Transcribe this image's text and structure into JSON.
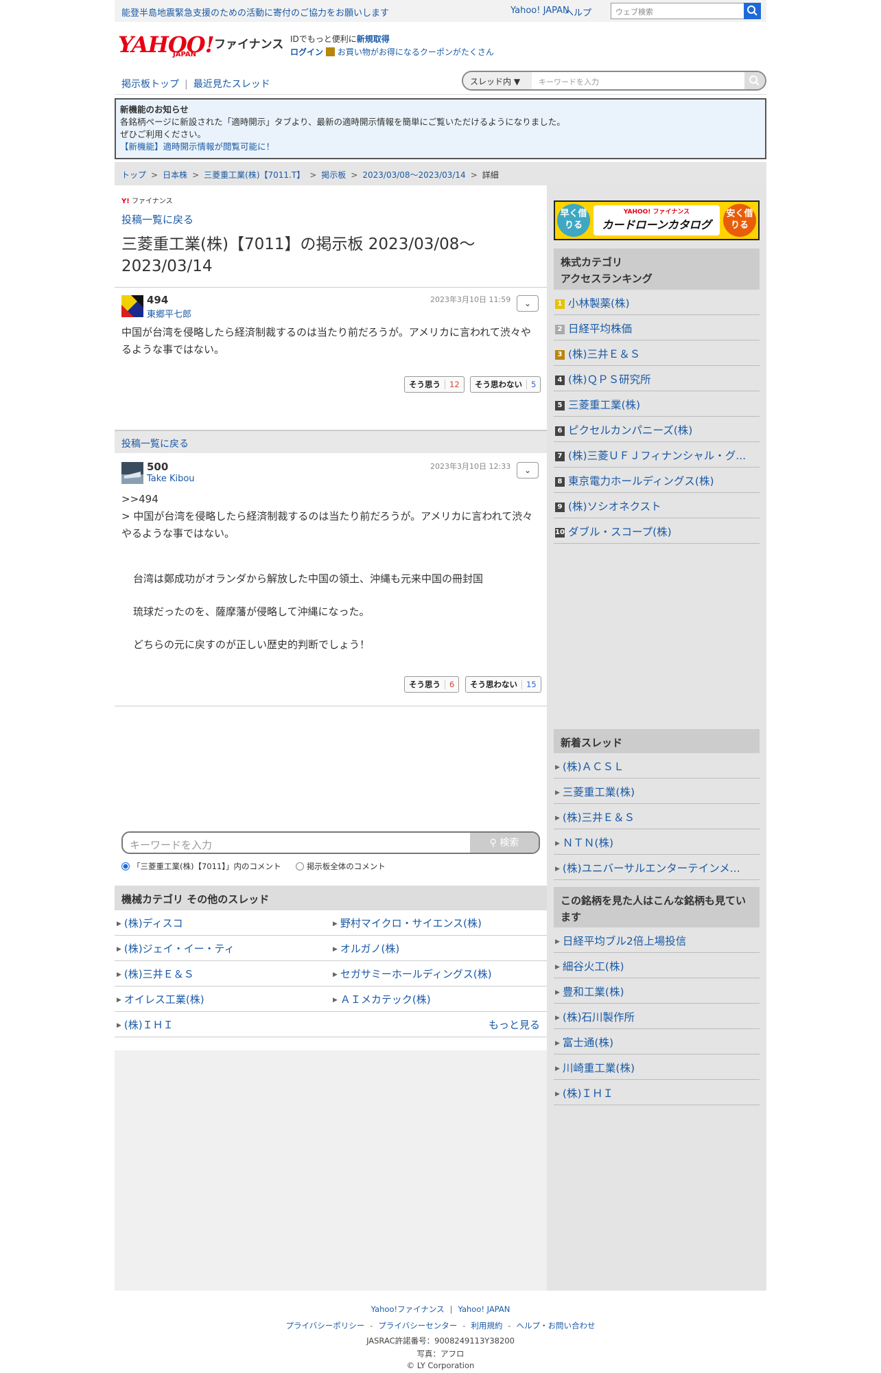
{
  "topbar": {
    "notice": "能登半島地震緊急支援のための活動に寄付のご協力をお願いします",
    "links": [
      "Yahoo! JAPAN",
      "ヘルプ"
    ],
    "search_placeholder": "ウェブ検索"
  },
  "header": {
    "logo_text": "YAHOO!",
    "logo_sub": "JAPAN",
    "service": "ファイナンス",
    "id_line_pre": "IDでもっと便利に",
    "id_line_link": "新規取得",
    "login": "ログイン",
    "coupon": "お買い物がお得になるクーポンがたくさん"
  },
  "boardnav": {
    "items": [
      "掲示板トップ",
      "最近見たスレッド"
    ],
    "scope": "スレッド内",
    "search_placeholder": "キーワードを入力"
  },
  "news": {
    "title": "新機能のお知らせ",
    "line1": "各銘柄ページに新設された「適時開示」タブより、最新の適時開示情報を簡単にご覧いただけるようになりました。",
    "line2": "ぜひご利用ください。",
    "link": "【新機能】適時開示情報が閲覧可能に！"
  },
  "breadcrumb": [
    "トップ",
    "日本株",
    "三菱重工業(株)【7011.T】",
    "掲示板",
    "2023/03/08〜2023/03/14",
    "詳細"
  ],
  "main": {
    "yf_mark": "Y!",
    "yf_label": "ファイナンス",
    "back_label": "投稿一覧に戻る",
    "title": "三菱重工業(株)【7011】の掲示板 2023/03/08〜2023/03/14",
    "posts": [
      {
        "num": "494",
        "name": "東郷平七郎",
        "date": "2023年3月10日 11:59",
        "body": "中国が台湾を侵略したら経済制裁するのは当たり前だろうが。アメリカに言われて渋々やるような事ではない。",
        "agree_label": "そう思う",
        "agree": "12",
        "disagree_label": "そう思わない",
        "disagree": "5"
      },
      {
        "num": "500",
        "name": "Take Kibou",
        "date": "2023年3月10日 12:33",
        "body": ">>494\n> 中国が台湾を侵略したら経済制裁するのは当たり前だろうが。アメリカに言われて渋々やるような事ではない。",
        "body2": "台湾は鄭成功がオランダから解放した中国の領土、沖縄も元来中国の冊封国\n\n琉球だったのを、薩摩藩が侵略して沖縄になった。\n\nどちらの元に戻すのが正しい歴史的判断でしょう！",
        "agree_label": "そう思う",
        "agree": "6",
        "disagree_label": "そう思わない",
        "disagree": "15"
      }
    ],
    "back2_label": "投稿一覧に戻る",
    "search_placeholder": "キーワードを入力",
    "search_btn": "検索",
    "radio1": "「三菱重工業(株)【7011】」内のコメント",
    "radio2": "掲示板全体のコメント",
    "other_head": "機械カテゴリ その他のスレッド",
    "other": [
      "(株)ディスコ",
      "野村マイクロ・サイエンス(株)",
      "(株)ジェイ・イー・ティ",
      "オルガノ(株)",
      "(株)三井Ｅ＆Ｓ",
      "セガサミーホールディングス(株)",
      "オイレス工業(株)",
      "ＡＩメカテック(株)",
      "(株)ＩＨＩ"
    ],
    "more": "もっと見る"
  },
  "side": {
    "banner": {
      "left": "早く借りる",
      "sub": "YAHOO! ファイナンス",
      "title": "カードローンカタログ",
      "right": "安く借りる"
    },
    "ranking_head": "株式カテゴリ\nアクセスランキング",
    "ranking": [
      "小林製薬(株)",
      "日経平均株価",
      "(株)三井Ｅ＆Ｓ",
      "(株)ＱＰＳ研究所",
      "三菱重工業(株)",
      "ピクセルカンパニーズ(株)",
      "(株)三菱ＵＦＪフィナンシャル・グ...",
      "東京電力ホールディングス(株)",
      "(株)ソシオネクスト",
      "ダブル・スコープ(株)"
    ],
    "new_head": "新着スレッド",
    "new_threads": [
      "(株)ＡＣＳＬ",
      "三菱重工業(株)",
      "(株)三井Ｅ＆Ｓ",
      "ＮＴＮ(株)",
      "(株)ユニバーサルエンターテインメ..."
    ],
    "also_head": "この銘柄を見た人はこんな銘柄も見ています",
    "also": [
      "日経平均ブル2倍上場投信",
      "細谷火工(株)",
      "豊和工業(株)",
      "(株)石川製作所",
      "富士通(株)",
      "川崎重工業(株)",
      "(株)ＩＨＩ"
    ]
  },
  "footer": {
    "row1": [
      "Yahoo!ファイナンス",
      "Yahoo! JAPAN"
    ],
    "row2": [
      "プライバシーポリシー",
      "プライバシーセンター",
      "利用規約",
      "ヘルプ・お問い合わせ"
    ],
    "jasrac": "JASRAC許諾番号：9008249113Y38200",
    "photo": "写真：アフロ",
    "copy": "© LY Corporation"
  },
  "colors": {
    "link": "#1a5aa6",
    "brand": "#e60012",
    "search_btn": "#1f6ad8"
  }
}
